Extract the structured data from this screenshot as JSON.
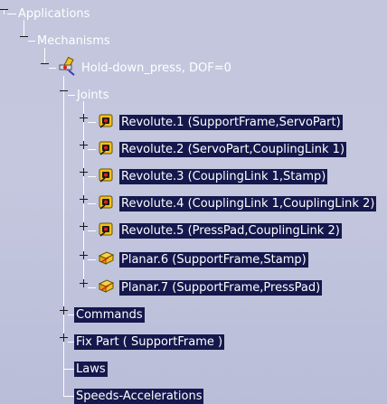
{
  "tree": {
    "applications": {
      "label": "Applications"
    },
    "mechanisms": {
      "label": "Mechanisms"
    },
    "mechanism": {
      "label": "Hold-down_press, DOF=0",
      "icon": "mechanism-icon"
    },
    "joints": {
      "label": "Joints",
      "items": [
        {
          "label": "Revolute.1 (SupportFrame,ServoPart)",
          "icon": "revolute-joint-icon"
        },
        {
          "label": "Revolute.2 (ServoPart,CouplingLink 1)",
          "icon": "revolute-joint-icon"
        },
        {
          "label": "Revolute.3 (CouplingLink 1,Stamp)",
          "icon": "revolute-joint-icon"
        },
        {
          "label": "Revolute.4 (CouplingLink 1,CouplingLink 2)",
          "icon": "revolute-joint-icon"
        },
        {
          "label": "Revolute.5 (PressPad,CouplingLink 2)",
          "icon": "revolute-joint-icon"
        },
        {
          "label": "Planar.6 (SupportFrame,Stamp)",
          "icon": "planar-joint-icon"
        },
        {
          "label": "Planar.7 (SupportFrame,PressPad)",
          "icon": "planar-joint-icon"
        }
      ]
    },
    "commands": {
      "label": "Commands"
    },
    "fix_part": {
      "label": "Fix Part ( SupportFrame )"
    },
    "laws": {
      "label": "Laws"
    },
    "speeds": {
      "label": "Speeds-Accelerations"
    }
  },
  "colors": {
    "background": "#c3c6dd",
    "node_highlight": "#15184c",
    "text": "#ffffff",
    "tree_line": "#ffffff"
  }
}
